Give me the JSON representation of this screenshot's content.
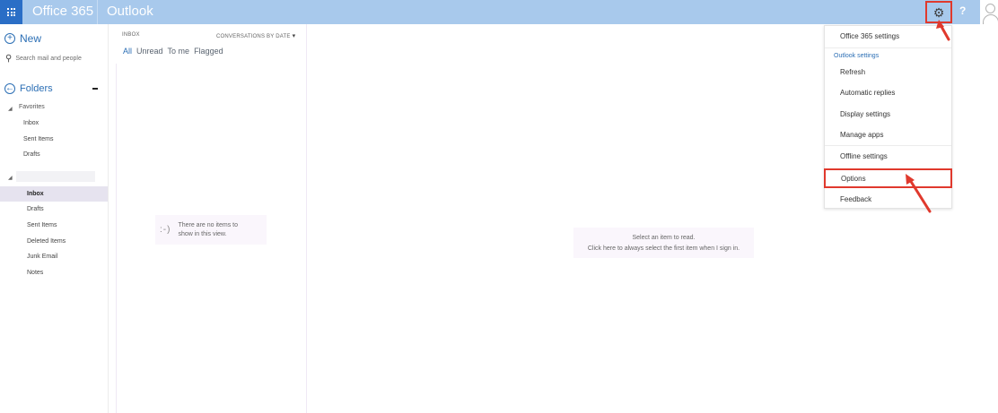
{
  "topbar": {
    "brand": "Office 365",
    "app": "Outlook",
    "help_label": "?",
    "accent": "#a8c9ec",
    "waffle_color": "#2a6ec6"
  },
  "icons": {
    "waffle": "app-launcher-icon",
    "gear": "gear-icon",
    "help": "help-icon",
    "avatar": "user-avatar-icon",
    "new": "plus-circle-icon",
    "search": "search-icon",
    "folders": "back-circle-icon"
  },
  "leftnav": {
    "new_label": "New",
    "search_placeholder": "Search mail and people",
    "folders_label": "Folders",
    "favorites_label": "Favorites",
    "favorites": [
      "Inbox",
      "Sent Items",
      "Drafts"
    ],
    "folders": [
      "Inbox",
      "Drafts",
      "Sent Items",
      "Deleted Items",
      "Junk Email",
      "Notes"
    ],
    "selected": "Inbox"
  },
  "list": {
    "folder_header": "INBOX",
    "sort_label": "CONVERSATIONS BY DATE",
    "filters": [
      "All",
      "Unread",
      "To me",
      "Flagged"
    ],
    "active_filter": "All",
    "empty_emoticon": ":-)",
    "empty_text": "There are no items to show in this view."
  },
  "reading": {
    "line1": "Select an item to read.",
    "line2": "Click here to always select the first item when I sign in."
  },
  "settings_menu": {
    "office_settings": "Office 365 settings",
    "section_label": "Outlook settings",
    "items": [
      "Refresh",
      "Automatic replies",
      "Display settings",
      "Manage apps",
      "Offline settings",
      "Options",
      "Feedback"
    ],
    "highlighted": "Options",
    "highlight_color": "#e0392d"
  }
}
